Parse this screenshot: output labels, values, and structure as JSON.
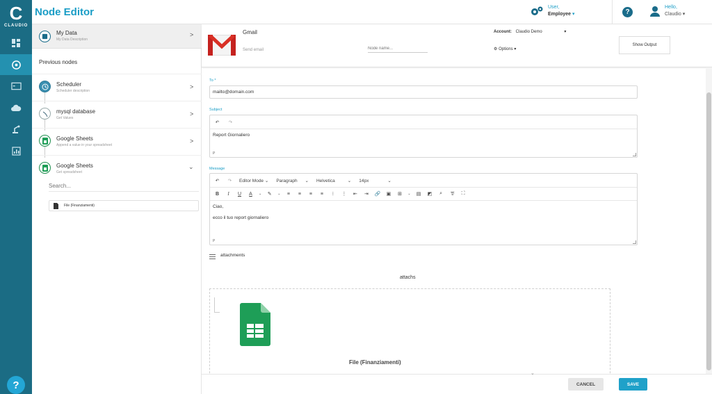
{
  "app": {
    "title": "Node Editor",
    "logo_text": "CLAUDIO"
  },
  "topbar": {
    "user_label": "User,",
    "user_role": "Employee",
    "hello_label": "Hello,",
    "hello_name": "Claudio"
  },
  "left_panel": {
    "my_data": {
      "title": "My Data",
      "description": "My Data Description"
    },
    "previous_label": "Previous nodes",
    "nodes": [
      {
        "title": "Scheduler",
        "description": "Scheduler description"
      },
      {
        "title": "mysql database",
        "description": "Get Values"
      },
      {
        "title": "Google Sheets",
        "description": "Append a value in your spreadsheet"
      },
      {
        "title": "Google Sheets",
        "description": "Get spreadsheet"
      }
    ],
    "search_placeholder": "Search...",
    "file_item": "File (Finanziamenti)"
  },
  "node_header": {
    "name": "Gmail",
    "action": "Send email",
    "name_placeholder": "Node name...",
    "account_label": "Account:",
    "account_value": "Claudio Demo",
    "options_label": "Options",
    "show_output": "Show Output"
  },
  "form": {
    "to_label": "To *",
    "to_value": "mailto@domain.com",
    "subject_label": "Subject",
    "subject_value": "Report Giornaliero",
    "subject_p": "P",
    "message_label": "Message",
    "editor_mode": "Editor Mode",
    "paragraph": "Paragraph",
    "font": "Helvetica",
    "font_size": "14px",
    "message_line1": "Ciao,",
    "message_line2": "ecco il tuo report giornaliero",
    "message_p": "P",
    "attachments_label": "attachments",
    "attachs_title": "attachs",
    "attached_file": "File (Finanziamenti)"
  },
  "footer": {
    "cancel": "CANCEL",
    "save": "SAVE"
  },
  "colors": {
    "rail": "#1b6c84",
    "accent": "#1a9dc6",
    "save": "#1fa1c9"
  }
}
